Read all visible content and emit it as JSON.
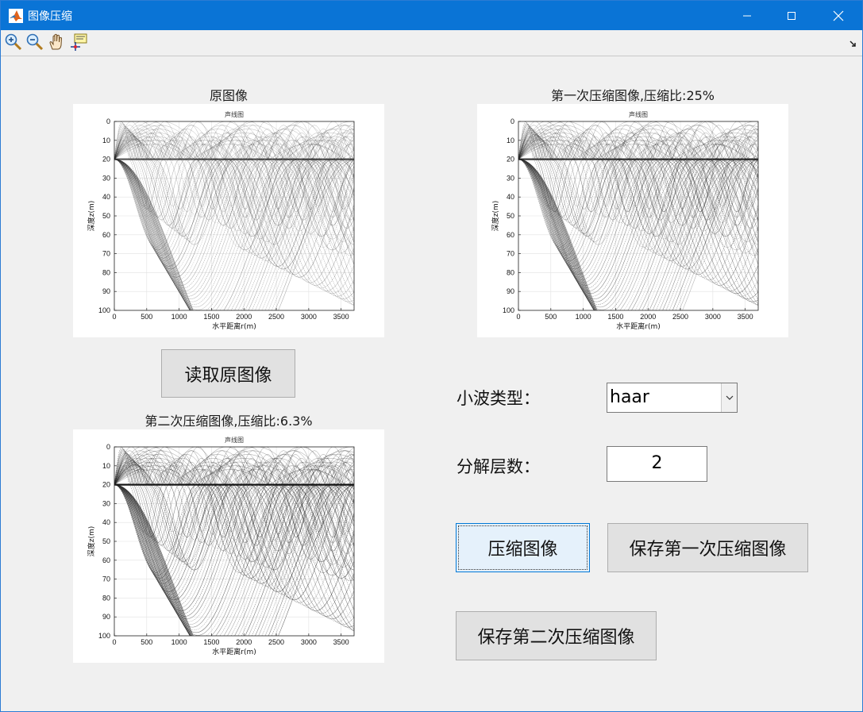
{
  "window": {
    "title": "图像压缩"
  },
  "toolbar": {
    "tools": [
      "zoom-in-icon",
      "zoom-out-icon",
      "pan-hand-icon",
      "data-cursor-icon"
    ]
  },
  "axes": {
    "original": {
      "title": "原图像"
    },
    "first": {
      "title": "第一次压缩图像,压缩比:25%"
    },
    "second": {
      "title": "第二次压缩图像,压缩比:6.3%"
    }
  },
  "plot": {
    "title_top": "声线图",
    "title_bottom": "声线图",
    "xlabel": "水平距离r(m)",
    "ylabel": "深度z(m)",
    "x_ticks": [
      "0",
      "500",
      "1000",
      "1500",
      "2000",
      "2500",
      "3000",
      "3500"
    ],
    "y_ticks": [
      "0",
      "10",
      "20",
      "30",
      "40",
      "50",
      "60",
      "70",
      "80",
      "90",
      "100"
    ]
  },
  "controls": {
    "read_button": "读取原图像",
    "wavelet_label": "小波类型：",
    "wavelet_value": "haar",
    "levels_label": "分解层数：",
    "levels_value": "2",
    "compress_button": "压缩图像",
    "save_first_button": "保存第一次压缩图像",
    "save_second_button": "保存第二次压缩图像"
  },
  "colors": {
    "titlebar": "#0a74d6",
    "button_bg": "#e1e1e1",
    "focused_button_bg": "#e5f1fb"
  },
  "chart_data": [
    {
      "type": "line",
      "title": "声线图",
      "xlabel": "水平距离r(m)",
      "ylabel": "深度z(m)",
      "xlim": [
        0,
        3700
      ],
      "ylim": [
        0,
        100
      ],
      "grid": true
    },
    {
      "type": "line",
      "title": "声线图",
      "xlabel": "水平距离r(m)",
      "ylabel": "深度z(m)",
      "xlim": [
        0,
        3700
      ],
      "ylim": [
        0,
        100
      ],
      "grid": true
    },
    {
      "type": "line",
      "title": "声线图",
      "xlabel": "水平距离r(m)",
      "ylabel": "深度z(m)",
      "xlim": [
        0,
        3700
      ],
      "ylim": [
        0,
        100
      ],
      "grid": true
    }
  ]
}
